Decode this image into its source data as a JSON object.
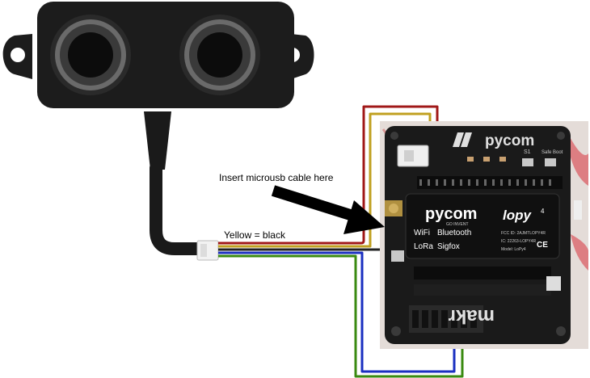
{
  "annotations": {
    "usb_instruction": "Insert microusb cable here",
    "wire_note": "Yellow = black"
  },
  "board": {
    "brand": "pycom",
    "module_brand": "pycom",
    "module_tagline": "GO INVENT",
    "module_name": "lopy",
    "module_version": "4",
    "features": [
      "WiFi",
      "Bluetooth",
      "LoRa",
      "Sigfox"
    ],
    "cert_lines": [
      "FCC ID: 2AJMTLOPY4R",
      "IC: 22263-LOPY4R",
      "Model: LoPy4"
    ],
    "cert_marks": "CE",
    "button_labels": [
      "S1",
      "Safe Boot"
    ],
    "carrier_logo": "makr"
  },
  "wires": [
    {
      "name": "red-wire",
      "color": "#a01818"
    },
    {
      "name": "yellow-wire",
      "color": "#c0a020"
    },
    {
      "name": "blue-wire",
      "color": "#1a2fc0"
    },
    {
      "name": "green-wire",
      "color": "#3a8a10"
    }
  ],
  "colors": {
    "sensor_body": "#1c1c1c",
    "pcb": "#1a1a1a",
    "module": "#101010",
    "arrow": "#000000"
  }
}
